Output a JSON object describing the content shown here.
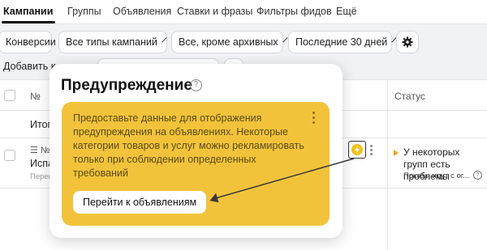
{
  "nav": {
    "tabs": [
      {
        "label": "Кампании"
      },
      {
        "label": "Группы"
      },
      {
        "label": "Объявления"
      },
      {
        "label": "Ставки и фразы"
      },
      {
        "label": "Фильтры фидов"
      },
      {
        "label": "Ещё"
      }
    ]
  },
  "filters": {
    "conversions": "Конверсии",
    "campaign_types": "Все типы кампаний",
    "archive": "Все, кроме архивных",
    "period": "Последние 30 дней"
  },
  "toolbar": {
    "add_label": "Добавить к"
  },
  "table": {
    "header_num": "№",
    "header_status": "Статус",
    "total_label": "Итого",
    "row": {
      "num": "№",
      "name": "Испа",
      "sub": "Перей"
    },
    "status_text": "У некоторых групп есть проблемы",
    "status_sub": "Показы идут с ог..."
  },
  "popup": {
    "title": "Предупреждение",
    "message": "Предоставьте данные для отображения предупреждения на объявлениях. Некоторые категории товаров и услуг можно рекламировать только при соблюдении определенных требований",
    "button_label": "Перейти к объявлениям"
  },
  "colors": {
    "card_bg": "#f2c33a",
    "warning_icon": "#f2c21a",
    "status_marker": "#f2a51a"
  }
}
